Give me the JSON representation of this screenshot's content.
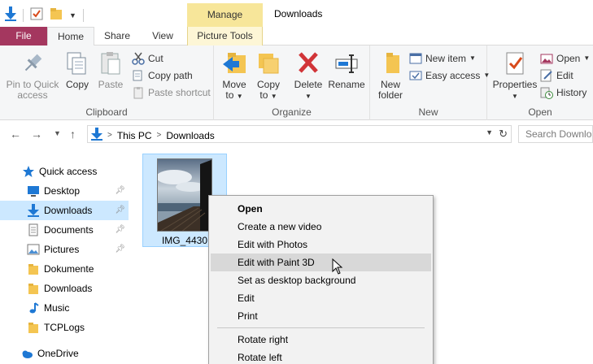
{
  "window": {
    "title": "Downloads",
    "context_tab_header": "Manage"
  },
  "tabs": {
    "file": "File",
    "home": "Home",
    "share": "Share",
    "view": "View",
    "picture_tools": "Picture Tools"
  },
  "ribbon": {
    "clipboard": {
      "label": "Clipboard",
      "pin_line1": "Pin to Quick",
      "pin_line2": "access",
      "copy": "Copy",
      "paste": "Paste",
      "cut": "Cut",
      "copy_path": "Copy path",
      "paste_shortcut": "Paste shortcut"
    },
    "organize": {
      "label": "Organize",
      "move_line1": "Move",
      "move_line2": "to",
      "copy_line1": "Copy",
      "copy_line2": "to",
      "delete": "Delete",
      "rename": "Rename"
    },
    "new": {
      "label": "New",
      "new_folder_line1": "New",
      "new_folder_line2": "folder",
      "new_item": "New item",
      "easy_access": "Easy access"
    },
    "open": {
      "label": "Open",
      "properties": "Properties",
      "open": "Open",
      "edit": "Edit",
      "history": "History"
    }
  },
  "address": {
    "crumbs": [
      "This PC",
      "Downloads"
    ],
    "search_placeholder": "Search Downloads"
  },
  "nav_pane": {
    "items": [
      {
        "label": "Quick access",
        "icon": "star-icon"
      },
      {
        "label": "Desktop",
        "icon": "desktop-icon",
        "pinned": true
      },
      {
        "label": "Downloads",
        "icon": "download-arrow-icon",
        "pinned": true,
        "selected": true
      },
      {
        "label": "Documents",
        "icon": "document-icon",
        "pinned": true
      },
      {
        "label": "Pictures",
        "icon": "pictures-icon",
        "pinned": true
      },
      {
        "label": "Dokumente",
        "icon": "folder-icon"
      },
      {
        "label": "Downloads",
        "icon": "folder-icon"
      },
      {
        "label": "Music",
        "icon": "music-icon"
      },
      {
        "label": "TCPLogs",
        "icon": "folder-icon"
      },
      {
        "label": "OneDrive",
        "icon": "cloud-icon"
      }
    ]
  },
  "files": [
    {
      "name": "IMG_4430",
      "selected": true
    }
  ],
  "context_menu": {
    "items": [
      {
        "label": "Open",
        "bold": true
      },
      {
        "label": "Create a new video"
      },
      {
        "label": "Edit with Photos"
      },
      {
        "label": "Edit with Paint 3D",
        "hovered": true
      },
      {
        "label": "Set as desktop background"
      },
      {
        "label": "Edit"
      },
      {
        "label": "Print"
      },
      {
        "label": "Rotate right"
      },
      {
        "label": "Rotate left"
      }
    ]
  },
  "colors": {
    "file_tab": "#a4375f",
    "manage_tab": "#f7e69a",
    "selection": "#cce8ff",
    "accent_blue": "#1e78d4"
  }
}
